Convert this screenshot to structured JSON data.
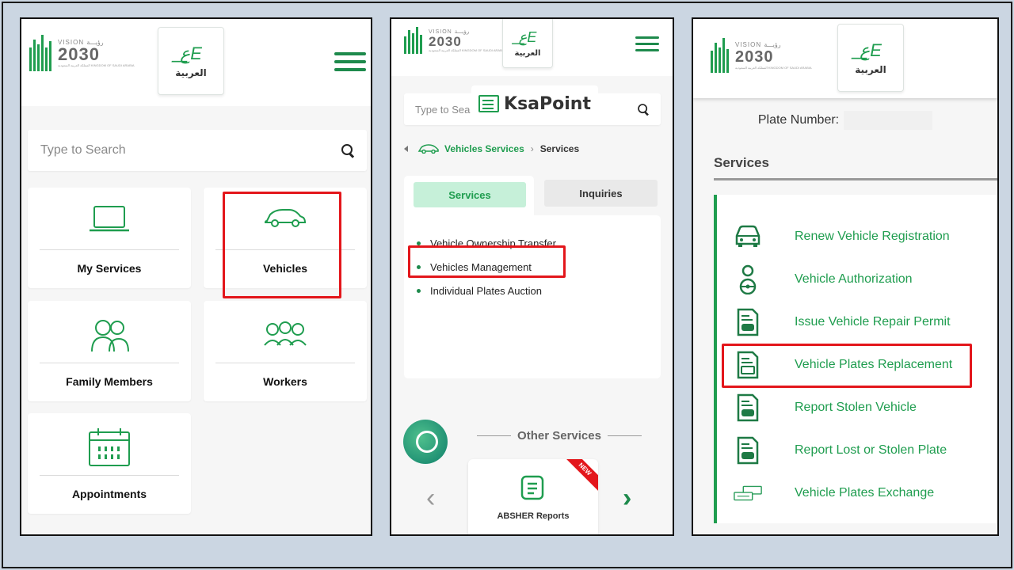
{
  "colors": {
    "brand_green": "#1f9d4f",
    "highlight_red": "#e3161b",
    "pill_green": "#c6f0d9"
  },
  "header": {
    "vision_top": "VISION رؤيـــة",
    "vision_year": "2030",
    "vision_sub": "المملكة العربية السعودية KINGDOM OF SAUDI ARABIA",
    "lang_label": "العربية"
  },
  "panel1": {
    "search_placeholder": "Type to Search",
    "tiles": [
      {
        "label": "My Services",
        "icon": "laptop-icon"
      },
      {
        "label": "Vehicles",
        "icon": "car-icon"
      },
      {
        "label": "Family Members",
        "icon": "family-icon"
      },
      {
        "label": "Workers",
        "icon": "workers-icon"
      },
      {
        "label": "Appointments",
        "icon": "calendar-icon"
      }
    ]
  },
  "panel2": {
    "search_placeholder": "Type to Sea",
    "watermark": "KsaPoint",
    "breadcrumb": {
      "link": "Vehicles Services",
      "current": "Services"
    },
    "tabs": {
      "services": "Services",
      "inquiries": "Inquiries"
    },
    "services": [
      "Vehicle Ownership Transfer",
      "Vehicles Management",
      "Individual Plates Auction"
    ],
    "other_services_title": "Other Services",
    "report_card_label": "ABSHER Reports",
    "new_badge": "NEW"
  },
  "panel3": {
    "plate_label": "Plate Number:",
    "services_title": "Services",
    "items": [
      {
        "label": "Renew Vehicle Registration",
        "icon": "car-front-icon"
      },
      {
        "label": "Vehicle Authorization",
        "icon": "driver-icon"
      },
      {
        "label": "Issue Vehicle Repair Permit",
        "icon": "document-car-icon"
      },
      {
        "label": "Vehicle Plates Replacement",
        "icon": "document-plate-icon"
      },
      {
        "label": "Report Stolen Vehicle",
        "icon": "document-car-icon"
      },
      {
        "label": "Report Lost or Stolen Plate",
        "icon": "document-car-icon"
      },
      {
        "label": "Vehicle Plates Exchange",
        "icon": "plates-exchange-icon"
      }
    ]
  }
}
